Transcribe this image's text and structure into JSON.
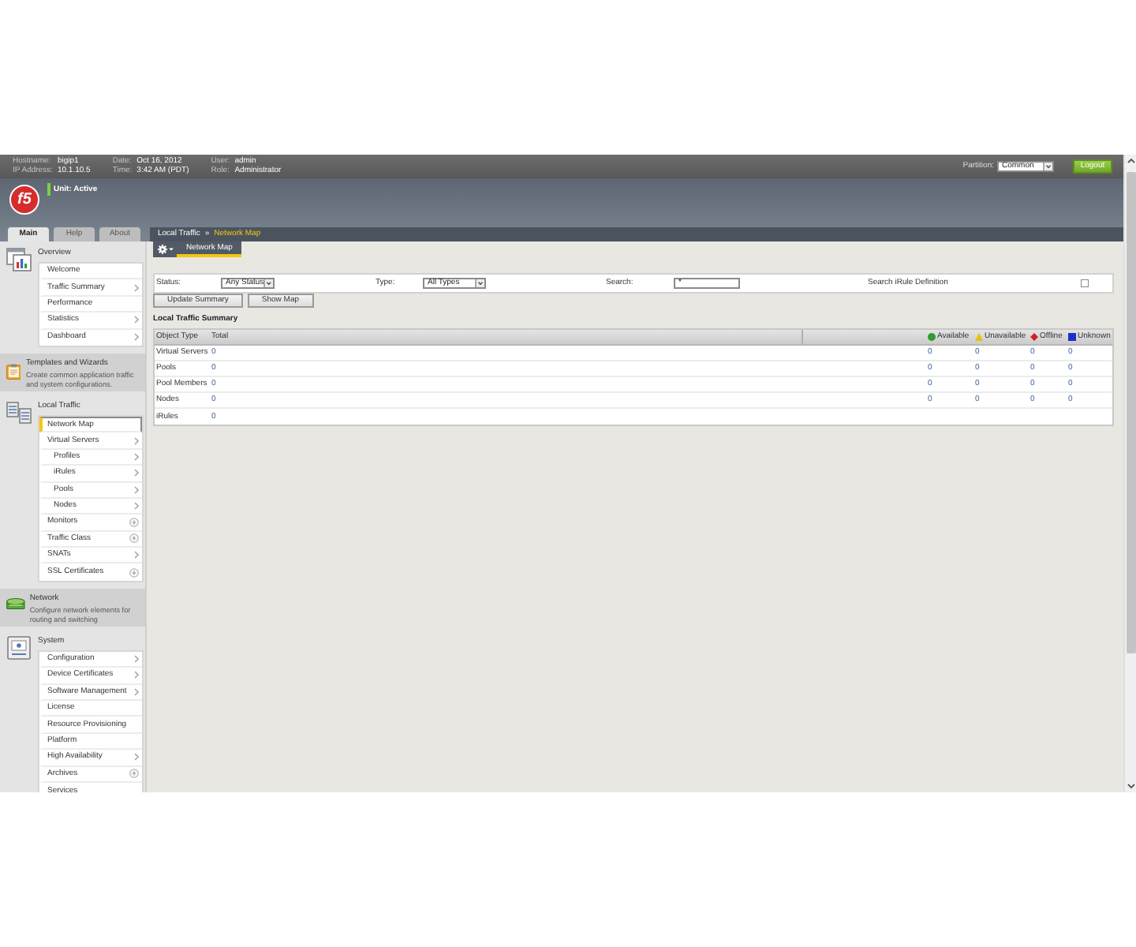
{
  "top_bar": {
    "info": [
      {
        "label": "Hostname:",
        "value": "bigip1"
      },
      {
        "label": "IP Address:",
        "value": "10.1.10.5"
      },
      {
        "label": "Date:",
        "value": "Oct 16, 2012"
      },
      {
        "label": "Time:",
        "value": "3:42 AM (PDT)"
      },
      {
        "label": "User:",
        "value": "admin"
      },
      {
        "label": "Role:",
        "value": "Administrator"
      }
    ],
    "partition": {
      "label": "Partition:",
      "value": "Common"
    },
    "logout_button": "Logout"
  },
  "banner": {
    "logo": "f5",
    "unit_status": "Unit: Active"
  },
  "tabs": [
    {
      "label": "Main",
      "selected": true
    },
    {
      "label": "Help",
      "selected": false
    },
    {
      "label": "About",
      "selected": false
    }
  ],
  "breadcrumb": {
    "items": [
      {
        "label": "Local Traffic",
        "current": false
      },
      {
        "label": "Network Map",
        "current": true
      }
    ],
    "separator": "»"
  },
  "sidebar": {
    "sections": [
      {
        "title": "Overview",
        "expanded": true,
        "items": [
          {
            "label": "Welcome",
            "kind": "link",
            "selected": false
          },
          {
            "label": "Traffic Summary",
            "kind": "submenu",
            "selected": false
          },
          {
            "label": "Performance",
            "kind": "link",
            "selected": false
          },
          {
            "label": "Statistics",
            "kind": "submenu",
            "selected": false
          },
          {
            "label": "Dashboard",
            "kind": "submenu",
            "selected": false
          }
        ]
      },
      {
        "title": "Templates and Wizards",
        "expanded": false,
        "description": "Create common application traffic and system configurations."
      },
      {
        "title": "Local Traffic",
        "expanded": true,
        "items": [
          {
            "label": "Network Map",
            "kind": "link",
            "selected": true
          },
          {
            "label": "Virtual Servers",
            "kind": "submenu",
            "selected": false,
            "children": [
              {
                "label": "Profiles",
                "kind": "submenu",
                "selected": false
              },
              {
                "label": "iRules",
                "kind": "submenu",
                "selected": false
              },
              {
                "label": "Pools",
                "kind": "submenu",
                "selected": false
              },
              {
                "label": "Nodes",
                "kind": "submenu",
                "selected": false
              }
            ]
          },
          {
            "label": "Monitors",
            "kind": "create",
            "selected": false
          },
          {
            "label": "Traffic Class",
            "kind": "create",
            "selected": false
          },
          {
            "label": "SNATs",
            "kind": "submenu",
            "selected": false
          },
          {
            "label": "SSL Certificates",
            "kind": "create",
            "selected": false
          }
        ]
      },
      {
        "title": "Network",
        "expanded": false,
        "description": "Configure network elements for routing and switching"
      },
      {
        "title": "System",
        "expanded": true,
        "items": [
          {
            "label": "Configuration",
            "kind": "submenu",
            "selected": false
          },
          {
            "label": "Device Certificates",
            "kind": "submenu",
            "selected": false
          },
          {
            "label": "Software Management",
            "kind": "submenu",
            "selected": false
          },
          {
            "label": "License",
            "kind": "link",
            "selected": false
          },
          {
            "label": "Resource Provisioning",
            "kind": "link",
            "selected": false
          },
          {
            "label": "Platform",
            "kind": "link",
            "selected": false
          },
          {
            "label": "High Availability",
            "kind": "submenu",
            "selected": false
          },
          {
            "label": "Archives",
            "kind": "create",
            "selected": false
          },
          {
            "label": "Services",
            "kind": "link",
            "selected": false
          }
        ]
      }
    ]
  },
  "page_tabs": [
    {
      "label": "Network Map",
      "selected": true
    }
  ],
  "filters": {
    "status": {
      "label": "Status:",
      "value": "Any Status"
    },
    "type": {
      "label": "Type:",
      "value": "All Types"
    },
    "search": {
      "label": "Search:",
      "value": "*"
    },
    "irule_search": {
      "label": "Search iRule Definition",
      "checked": false
    }
  },
  "buttons": [
    "Update Summary",
    "Show Map"
  ],
  "summary": {
    "title": "Local Traffic Summary",
    "columns": [
      {
        "label": "Object Type"
      },
      {
        "label": "Total"
      },
      {
        "label": "Available",
        "kind": "available",
        "color": "#2e9e2e"
      },
      {
        "label": "Unavailable",
        "kind": "unavailable",
        "color": "#e6c200"
      },
      {
        "label": "Offline",
        "kind": "offline",
        "color": "#d42020"
      },
      {
        "label": "Unknown",
        "kind": "unknown",
        "color": "#1f2fc8"
      }
    ],
    "rows": [
      {
        "object_type": "Virtual Servers",
        "total": "0",
        "counts": [
          "0",
          "0",
          "0",
          "0"
        ]
      },
      {
        "object_type": "Pools",
        "total": "0",
        "counts": [
          "0",
          "0",
          "0",
          "0"
        ]
      },
      {
        "object_type": "Pool Members",
        "total": "0",
        "counts": [
          "0",
          "0",
          "0",
          "0"
        ]
      },
      {
        "object_type": "Nodes",
        "total": "0",
        "counts": [
          "0",
          "0",
          "0",
          "0"
        ]
      },
      {
        "object_type": "iRules",
        "total": "0"
      }
    ]
  }
}
